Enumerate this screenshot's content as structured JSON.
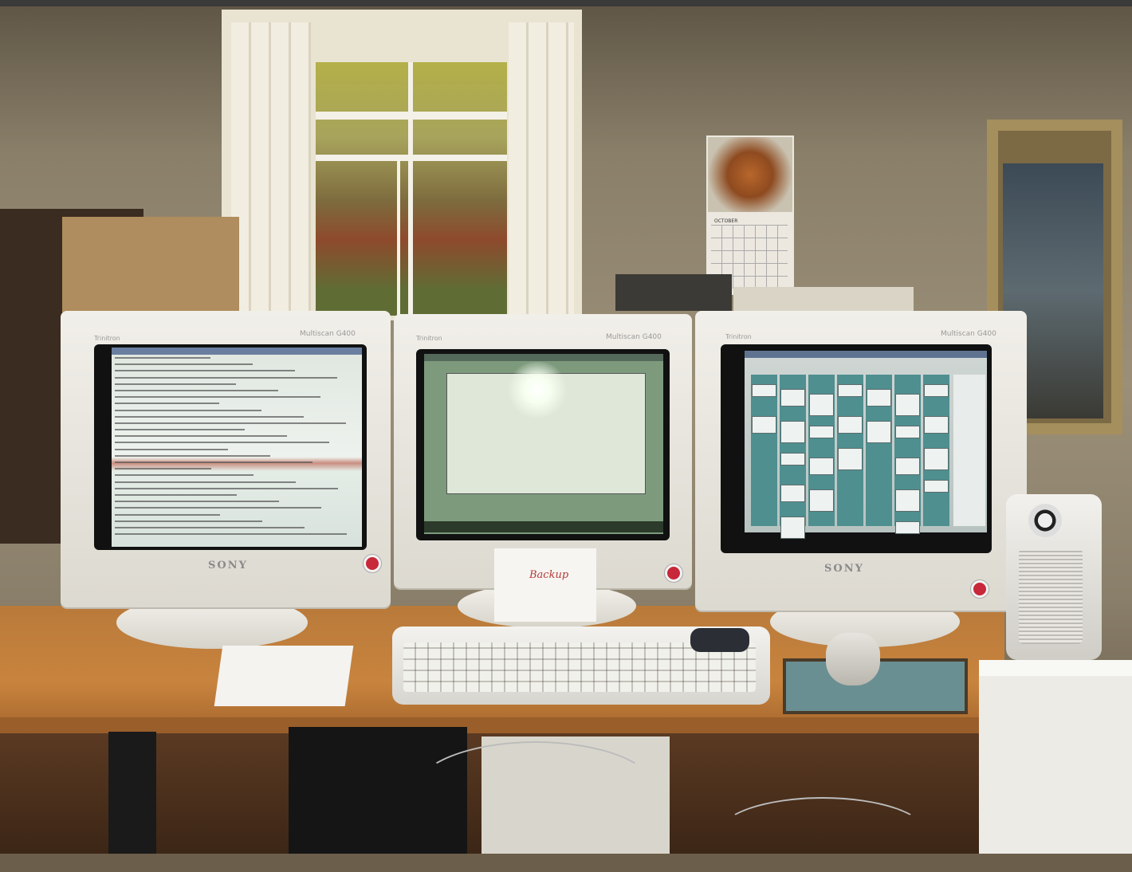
{
  "scene": {
    "description_hidden": "",
    "calendar_month": "OCTOBER"
  },
  "monitors": {
    "left": {
      "brand_small": "Trinitron",
      "model": "Multiscan G400",
      "logo": "SONY"
    },
    "middle": {
      "brand_small": "Trinitron",
      "model": "Multiscan G400"
    },
    "right": {
      "brand_small": "Trinitron",
      "model": "Multiscan G400",
      "logo": "SONY"
    }
  },
  "note_card": {
    "text": "Backup"
  },
  "colors": {
    "desk": "#c8843e",
    "monitor": "#eceae3",
    "screen_teal": "#4f8f90",
    "sony_badge": "#c7283a"
  },
  "icons": [
    "sony-badge-icon",
    "speaker-icon",
    "mouse-icon",
    "keyboard-icon"
  ]
}
